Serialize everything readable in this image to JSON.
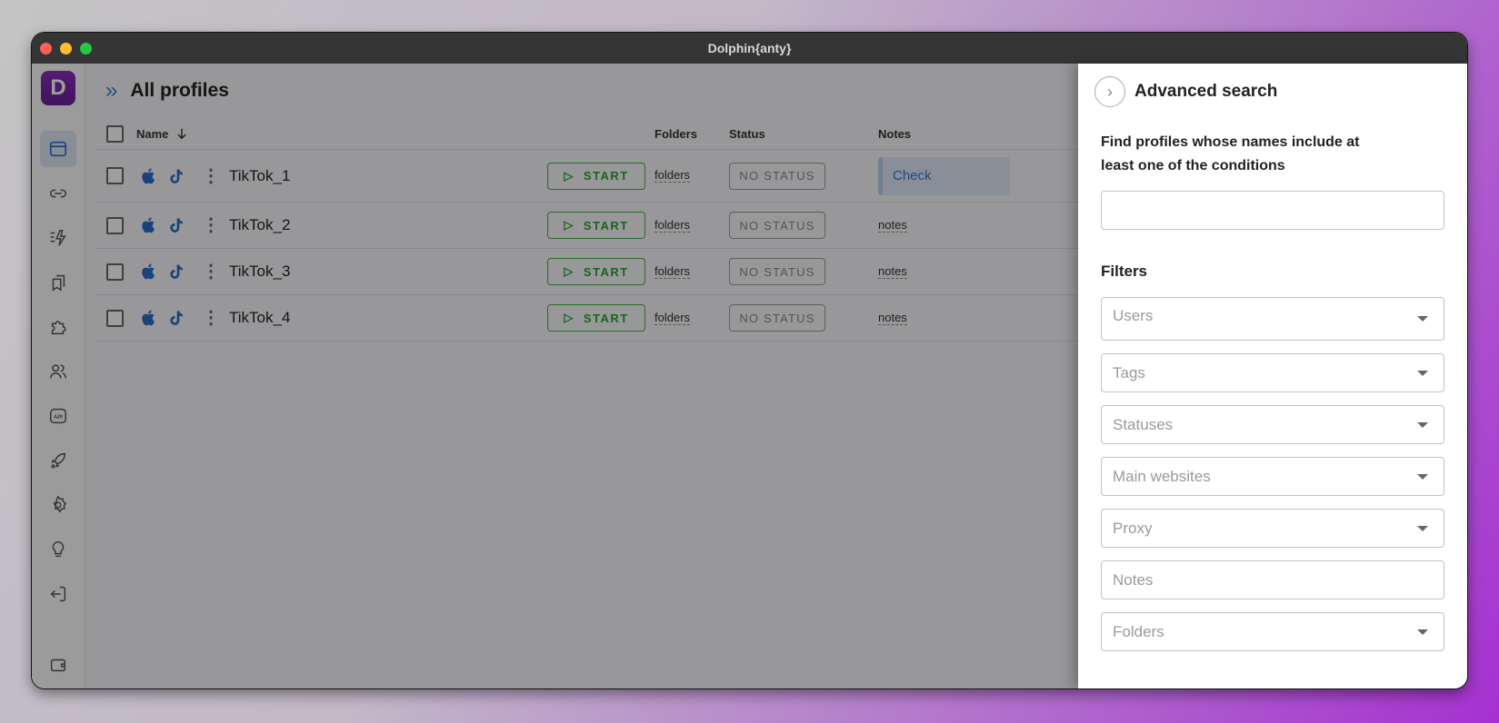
{
  "window": {
    "title": "Dolphin{anty}"
  },
  "sidebar": {
    "logo_letter": "D",
    "items": [
      {
        "name": "profiles",
        "icon": "browser-window-icon",
        "active": true
      },
      {
        "name": "proxies",
        "icon": "link-icon"
      },
      {
        "name": "automation",
        "icon": "lightning-icon"
      },
      {
        "name": "bookmarks",
        "icon": "bookmarks-icon"
      },
      {
        "name": "extensions",
        "icon": "puzzle-icon"
      },
      {
        "name": "users",
        "icon": "users-icon"
      },
      {
        "name": "api",
        "icon": "api-icon",
        "label": "API"
      },
      {
        "name": "scenarios",
        "icon": "rocket-icon"
      },
      {
        "name": "settings",
        "icon": "gear-icon"
      },
      {
        "name": "tips",
        "icon": "lightbulb-icon"
      },
      {
        "name": "logout",
        "icon": "logout-icon"
      },
      {
        "name": "wallet",
        "icon": "wallet-icon"
      }
    ]
  },
  "header": {
    "title": "All profiles",
    "actions": [
      "add-icon",
      "filter-icon",
      "refresh-icon"
    ]
  },
  "table": {
    "columns": {
      "name": "Name",
      "folders": "Folders",
      "status": "Status",
      "notes": "Notes"
    },
    "rows": [
      {
        "name": "TikTok_1",
        "start": "START",
        "folders": "folders",
        "status": "NO STATUS",
        "notes": "Check"
      },
      {
        "name": "TikTok_2",
        "start": "START",
        "folders": "folders",
        "status": "NO STATUS",
        "notes": "notes"
      },
      {
        "name": "TikTok_3",
        "start": "START",
        "folders": "folders",
        "status": "NO STATUS",
        "notes": "notes"
      },
      {
        "name": "TikTok_4",
        "start": "START",
        "folders": "folders",
        "status": "NO STATUS",
        "notes": "notes"
      }
    ]
  },
  "advanced_search": {
    "title": "Advanced search",
    "description": "Find profiles whose names include at least one of the conditions",
    "search_value": "",
    "filters_label": "Filters",
    "filters": {
      "users": "Users",
      "tags": "Tags",
      "statuses": "Statuses",
      "main_websites": "Main websites",
      "proxy": "Proxy",
      "notes": "Notes",
      "folders": "Folders"
    }
  },
  "colors": {
    "accent": "#2a6cc4",
    "start": "#3fb13f",
    "brand": "#7b27a8"
  }
}
